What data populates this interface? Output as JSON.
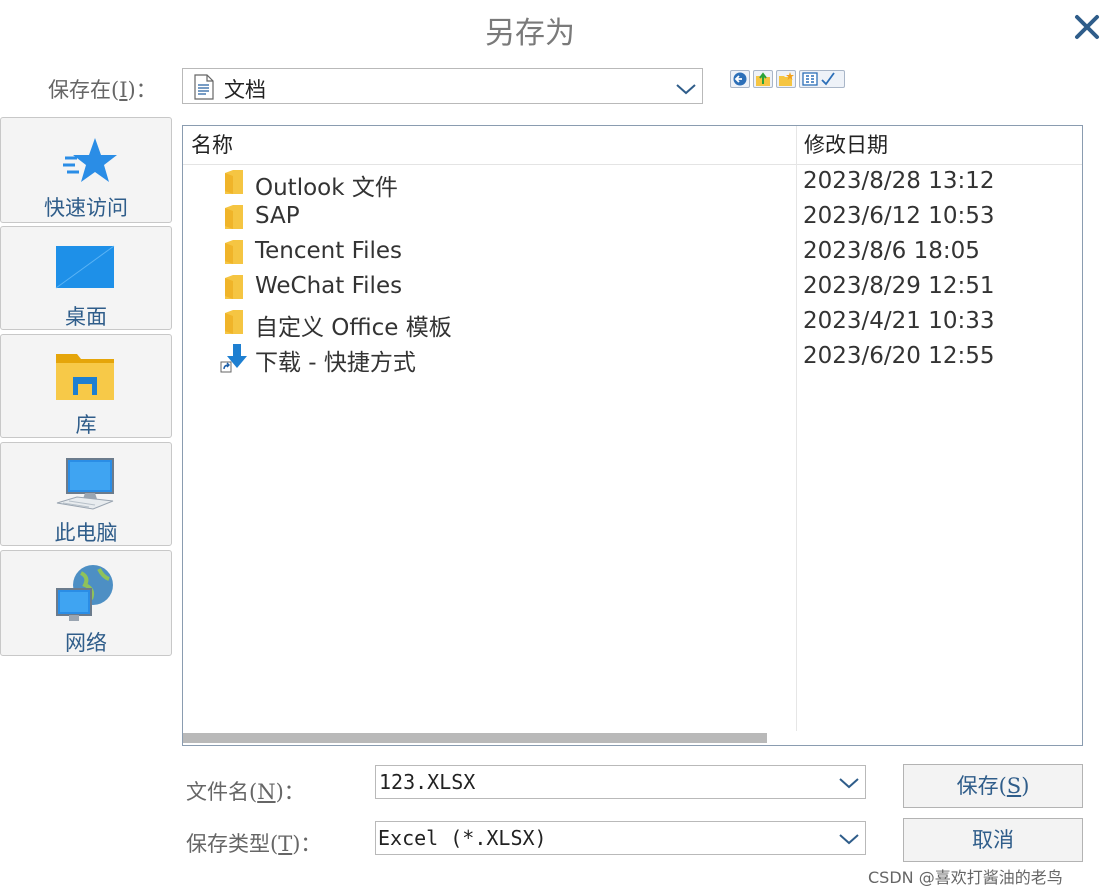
{
  "dialog": {
    "title": "另存为"
  },
  "location": {
    "label_pre": "保存在(",
    "label_key": "I",
    "label_post": ")：",
    "value": "文档"
  },
  "places": [
    {
      "label": "快速访问"
    },
    {
      "label": "桌面"
    },
    {
      "label": "库"
    },
    {
      "label": "此电脑"
    },
    {
      "label": "网络"
    }
  ],
  "columns": {
    "name": "名称",
    "date": "修改日期"
  },
  "files": [
    {
      "name": "Outlook 文件",
      "date": "2023/8/28 13:12",
      "type": "folder"
    },
    {
      "name": "SAP",
      "date": "2023/6/12 10:53",
      "type": "folder"
    },
    {
      "name": "Tencent Files",
      "date": "2023/8/6 18:05",
      "type": "folder"
    },
    {
      "name": "WeChat Files",
      "date": "2023/8/29 12:51",
      "type": "folder"
    },
    {
      "name": "自定义 Office 模板",
      "date": "2023/4/21 10:33",
      "type": "folder"
    },
    {
      "name": "下载 - 快捷方式",
      "date": "2023/6/20 12:55",
      "type": "shortcut"
    }
  ],
  "filename": {
    "label_pre": "文件名(",
    "label_key": "N",
    "label_post": ")：",
    "value": "123.XLSX"
  },
  "filetype": {
    "label_pre": "保存类型(",
    "label_key": "T",
    "label_post": ")：",
    "value": "Excel (*.XLSX)"
  },
  "buttons": {
    "save_pre": "保存(",
    "save_key": "S",
    "save_post": ")",
    "cancel": "取消"
  },
  "watermark": "CSDN @喜欢打酱油的老鸟",
  "colors": {
    "accent": "#2f5d8a",
    "folder": "#f5c542",
    "sky": "#1e90e8"
  }
}
